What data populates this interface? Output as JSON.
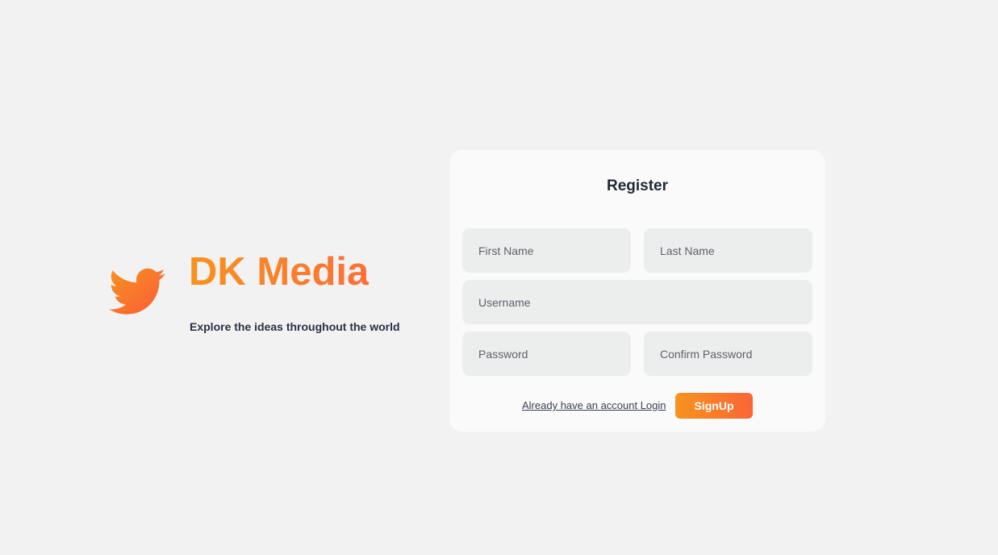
{
  "brand": {
    "icon": "bird-icon",
    "name": "DK Media",
    "tagline": "Explore the ideas throughout the world",
    "gradient": [
      "#f7931e",
      "#fb6f38"
    ]
  },
  "register": {
    "title": "Register",
    "fields": {
      "first_name": {
        "placeholder": "First Name",
        "value": ""
      },
      "last_name": {
        "placeholder": "Last Name",
        "value": ""
      },
      "username": {
        "placeholder": "Username",
        "value": ""
      },
      "password": {
        "placeholder": "Password",
        "value": ""
      },
      "confirm_password": {
        "placeholder": "Confirm Password",
        "value": ""
      }
    },
    "login_link": "Already have an account Login",
    "signup_label": "SignUp"
  },
  "colors": {
    "background": "#f2f2f2",
    "card": "#fafafa",
    "field": "#eceeee",
    "accent_start": "#f7931e",
    "accent_end": "#fb6536",
    "text_dark": "#1f2937"
  }
}
